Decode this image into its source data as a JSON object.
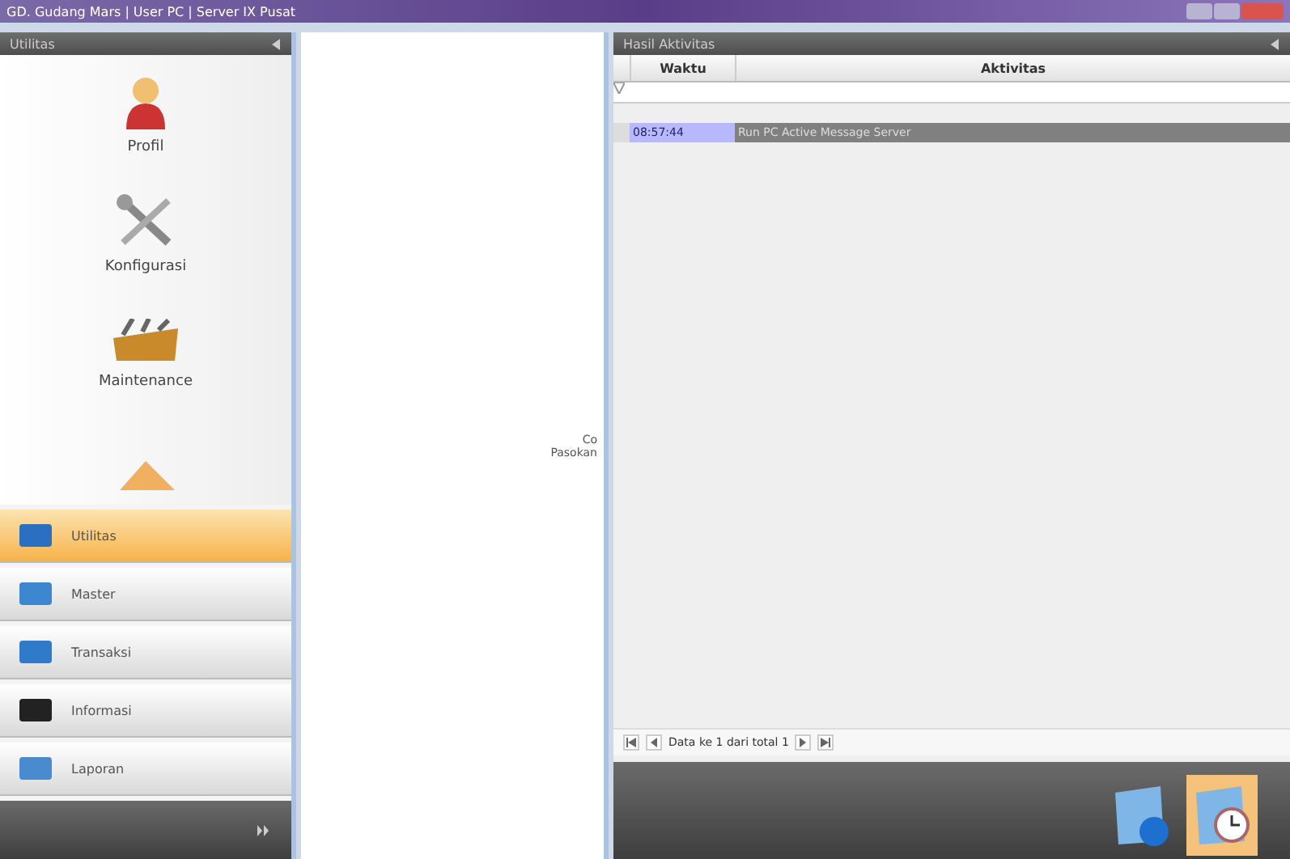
{
  "window": {
    "title": "GD. Gudang Mars | User PC | Server IX Pusat"
  },
  "sidebar": {
    "title": "Utilitas",
    "items": [
      {
        "label": "Profil",
        "kind": "profile"
      },
      {
        "label": "Konfigurasi",
        "kind": "tools"
      },
      {
        "label": "Maintenance",
        "kind": "toolbox"
      },
      {
        "kind": "partial"
      }
    ],
    "groups": [
      {
        "label": "Utilitas",
        "selected": true
      },
      {
        "label": "Master",
        "selected": false
      },
      {
        "label": "Transaksi",
        "selected": false
      },
      {
        "label": "Informasi",
        "selected": false
      },
      {
        "label": "Laporan",
        "selected": false
      }
    ]
  },
  "center": {
    "lines": [
      "Co",
      "Pasokan"
    ]
  },
  "activity": {
    "title": "Hasil Aktivitas",
    "columns": [
      "Waktu",
      "Aktivitas"
    ],
    "rows": [
      {
        "time": "08:57:44",
        "text": "Run PC Active Message Server",
        "selected": true
      }
    ],
    "pager": "Data ke 1 dari total 1"
  },
  "dock": [
    {
      "kind": "globe",
      "selected": false
    },
    {
      "kind": "clock",
      "selected": true
    }
  ]
}
